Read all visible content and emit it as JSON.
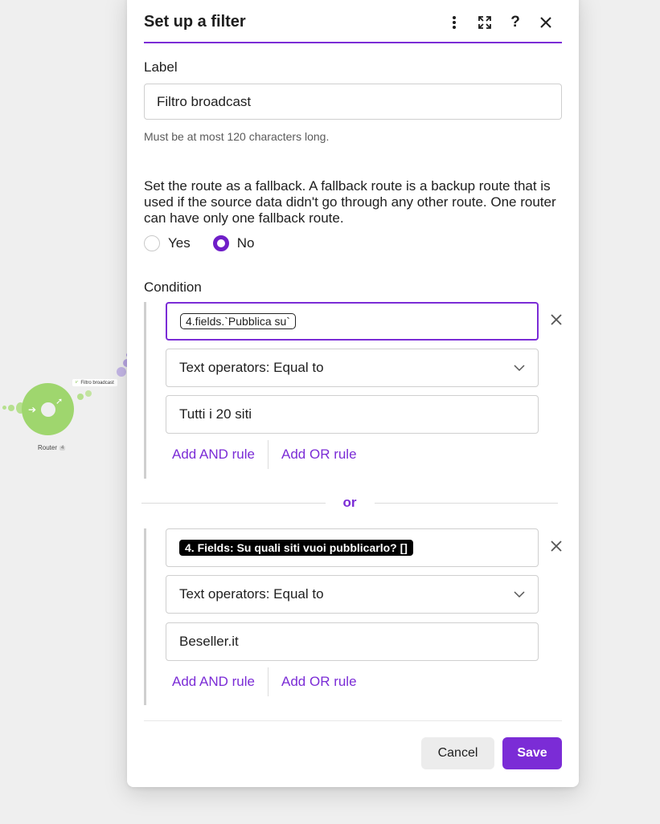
{
  "canvas": {
    "router_label": "Router",
    "router_badge": "4",
    "filter_tag": "Filtro broadcast"
  },
  "modal": {
    "title": "Set up a filter",
    "icons": [
      "more-vertical-icon",
      "expand-icon",
      "help-icon",
      "close-icon"
    ],
    "label_field": {
      "label": "Label",
      "value": "Filtro broadcast",
      "hint": "Must be at most 120 characters long."
    },
    "fallback": {
      "description": "Set the route as a fallback. A fallback route is a backup route that is used if the source data didn't go through any other route. One router can have only one fallback route.",
      "options": [
        "Yes",
        "No"
      ],
      "selected": "No"
    },
    "condition": {
      "label": "Condition",
      "groups": [
        {
          "field_pill": "4.fields.`Pubblica su`",
          "operator": "Text operators: Equal to",
          "value": "Tutti i 20 siti",
          "add_and": "Add AND rule",
          "add_or": "Add OR rule"
        },
        {
          "field_pill": "4. Fields: Su quali siti vuoi pubblicarlo? []",
          "operator": "Text operators: Equal to",
          "value": "Beseller.it",
          "add_and": "Add AND rule",
          "add_or": "Add OR rule"
        }
      ],
      "or_separator": "or"
    },
    "buttons": {
      "cancel": "Cancel",
      "save": "Save"
    }
  },
  "colors": {
    "accent": "#7b2cd6",
    "router_green": "#9fd66e"
  }
}
